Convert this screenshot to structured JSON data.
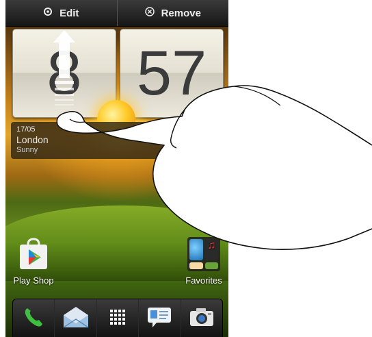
{
  "topbar": {
    "edit_label": "Edit",
    "remove_label": "Remove"
  },
  "clock": {
    "hour": "8",
    "minute": "57"
  },
  "weather": {
    "date": "17/05",
    "city": "London",
    "condition": "Sunny"
  },
  "apps": {
    "play_shop": "Play Shop",
    "favorites": "Favorites"
  },
  "dock": [
    "phone-icon",
    "mail-icon",
    "all-apps-icon",
    "messages-icon",
    "camera-icon"
  ]
}
